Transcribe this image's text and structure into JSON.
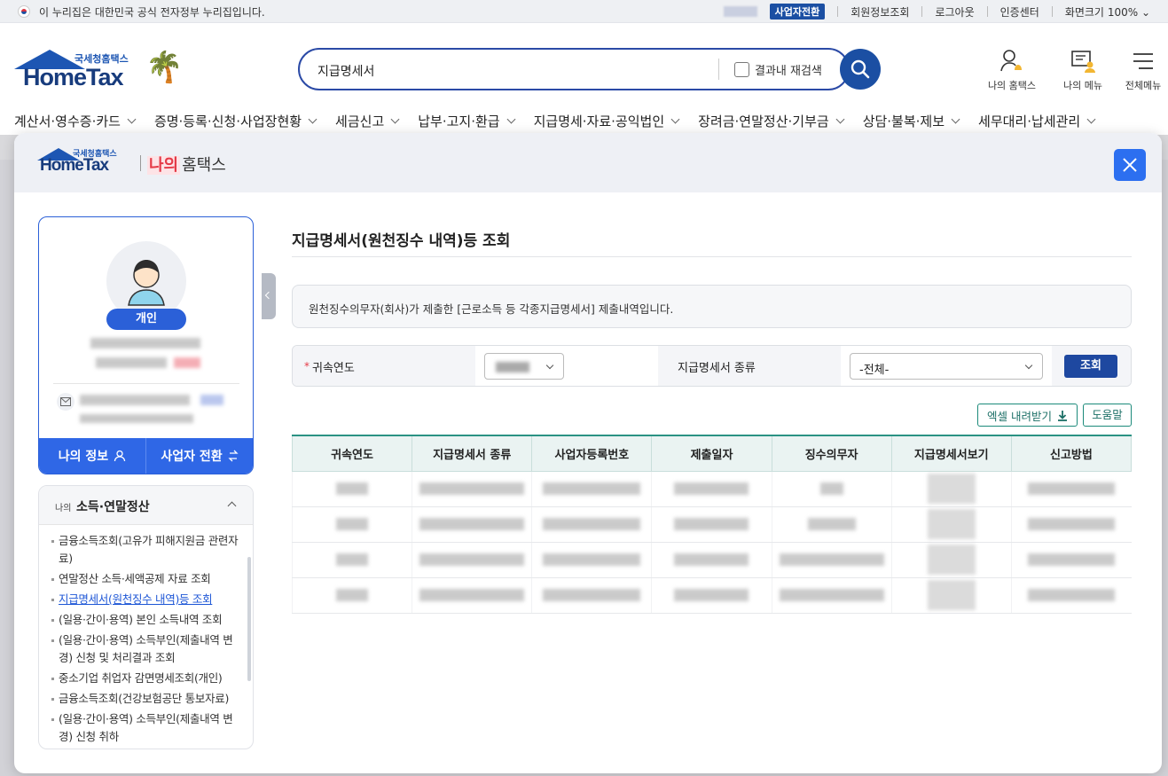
{
  "gov_bar": {
    "notice": "이 누리집은 대한민국 공식 전자정부 누리집입니다.",
    "links": [
      "사업자전환",
      "회원정보조회",
      "로그아웃",
      "인증센터"
    ],
    "zoom_label": "화면크기",
    "zoom_value": "100%"
  },
  "header": {
    "logo_sub": "국세청홈택스",
    "logo_main": "HomeTax",
    "search_query": "지급명세서",
    "search_recheck": "결과내 재검색",
    "icons": [
      {
        "label": "나의 홈택스",
        "icon": "person-bell-icon"
      },
      {
        "label": "나의 메뉴",
        "icon": "menu-person-icon"
      },
      {
        "label": "전체메뉴",
        "icon": "hamburger-icon"
      }
    ]
  },
  "gnb": [
    "계산서·영수증·카드",
    "증명·등록·신청·사업장현황",
    "세금신고",
    "납부·고지·환급",
    "지급명세·자료·공익법인",
    "장려금·연말정산·기부금",
    "상담·불복·제보",
    "세무대리·납세관리"
  ],
  "modal": {
    "logo_sub": "국세청홈택스",
    "logo_main": "HomeTax",
    "title_red": "나의",
    "title_rest": "홈택스",
    "profile": {
      "badge": "개인",
      "btn_myinfo": "나의 정보",
      "btn_biz_switch": "사업자 전환"
    },
    "side_menu": {
      "small": "나의",
      "title": "소득·연말정산",
      "items": [
        "금융소득조회(고유가 피해지원금 관련자료)",
        "연말정산 소득·세액공제 자료 조회",
        "지급명세서(원천징수 내역)등 조회",
        "(일용·간이·용역) 본인 소득내역 조회",
        "(일용·간이·용역) 소득부인(제출내역 변경) 신청 및 처리결과 조회",
        "중소기업 취업자 감면명세조회(개인)",
        "금융소득조회(건강보험공단 통보자료)",
        "(일용·간이·용역) 소득부인(제출내역 변경) 신청 취하"
      ],
      "active_index": 2
    },
    "content": {
      "title": "지급명세서(원천징수 내역)등 조회",
      "info": "원천징수의무자(회사)가 제출한 [근로소득 등 각종지급명세서] 제출내역입니다.",
      "filter": {
        "year_label": "귀속연도",
        "required_mark": "*",
        "type_label": "지급명세서 종류",
        "type_value": "-전체-",
        "search_btn": "조회"
      },
      "btn_excel": "엑셀 내려받기",
      "btn_help": "도움말",
      "table": {
        "columns": [
          "귀속연도",
          "지급명세서 종류",
          "사업자등록번호",
          "제출일자",
          "징수의무자",
          "지급명세서보기",
          "신고방법"
        ],
        "row_count": 4
      }
    }
  }
}
